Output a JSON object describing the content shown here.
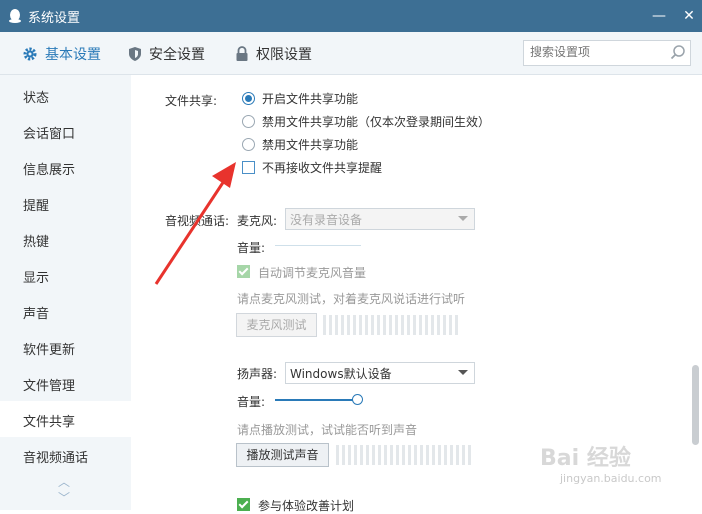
{
  "window": {
    "title": "系统设置",
    "minimize_label": "—",
    "close_label": "✕"
  },
  "tabs": [
    {
      "label": "基本设置",
      "icon": "gear-icon",
      "active": true
    },
    {
      "label": "安全设置",
      "icon": "shield-icon"
    },
    {
      "label": "权限设置",
      "icon": "lock-icon"
    }
  ],
  "search": {
    "placeholder": "搜索设置项"
  },
  "sidebar": {
    "items": [
      {
        "label": "状态"
      },
      {
        "label": "会话窗口"
      },
      {
        "label": "信息展示"
      },
      {
        "label": "提醒"
      },
      {
        "label": "热键"
      },
      {
        "label": "显示"
      },
      {
        "label": "声音"
      },
      {
        "label": "软件更新"
      },
      {
        "label": "文件管理"
      },
      {
        "label": "文件共享",
        "active": true
      },
      {
        "label": "音视频通话"
      }
    ],
    "up_arrow": "︿",
    "down_arrow": "﹀"
  },
  "file_share": {
    "section_label": "文件共享:",
    "options": [
      {
        "label": "开启文件共享功能",
        "selected": true
      },
      {
        "label": "禁用文件共享功能（仅本次登录期间生效）",
        "selected": false
      },
      {
        "label": "禁用文件共享功能",
        "selected": false
      }
    ],
    "no_remind_label": "不再接收文件共享提醒",
    "no_remind_checked": false
  },
  "av_call": {
    "section_label": "音视频通话:",
    "mic_label": "麦克风:",
    "mic_value": "没有录音设备",
    "mic_volume_label": "音量:",
    "auto_adjust_label": "自动调节麦克风音量",
    "auto_adjust_checked": true,
    "mic_test_hint": "请点麦克风测试，对着麦克风说话进行试听",
    "mic_test_button": "麦克风测试",
    "speaker_label": "扬声器:",
    "speaker_value": "Windows默认设备",
    "speaker_volume_label": "音量:",
    "speaker_volume": 1.0,
    "speaker_test_hint": "请点播放测试，试试能否听到声音",
    "speaker_test_button": "播放测试声音",
    "experience_label": "参与体验改善计划",
    "experience_checked": true
  },
  "watermark": {
    "text": "Bai 经验",
    "url": "jingyan.baidu.com"
  },
  "annotation_color": "#e8332d",
  "accent_color": "#2a7ab8"
}
